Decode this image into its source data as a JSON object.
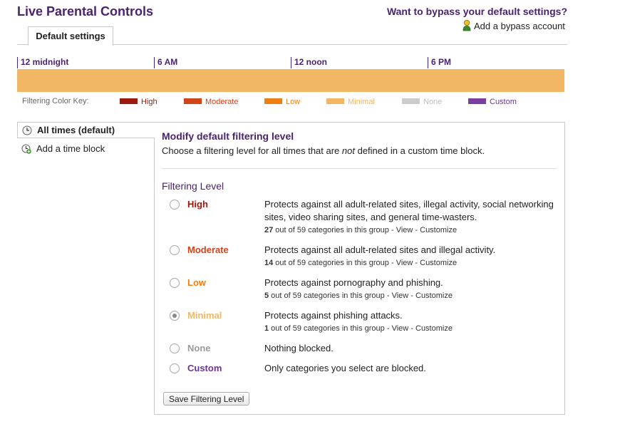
{
  "header": {
    "title": "Live Parental Controls",
    "bypass_question": "Want to bypass your default settings?",
    "bypass_link": "Add a bypass account"
  },
  "tabs": [
    {
      "label": "Default settings",
      "selected": true
    }
  ],
  "timeline": {
    "labels": [
      "12 midnight",
      "6 AM",
      "12 noon",
      "6 PM"
    ],
    "bar_color": "#f1b765"
  },
  "color_key": {
    "title": "Filtering Color Key:",
    "items": [
      {
        "label": "High",
        "color": "#9b1a0e",
        "text_color": "#9b1a0e"
      },
      {
        "label": "Moderate",
        "color": "#d2431a",
        "text_color": "#d2431a"
      },
      {
        "label": "Low",
        "color": "#f07f13",
        "text_color": "#f07f13"
      },
      {
        "label": "Minimal",
        "color": "#f1b765",
        "text_color": "#f1b765"
      },
      {
        "label": "None",
        "color": "#cccccc",
        "text_color": "#bdbdbd"
      },
      {
        "label": "Custom",
        "color": "#7b3fa2",
        "text_color": "#6b3596"
      }
    ]
  },
  "sidebar": {
    "items": [
      {
        "label": "All times (default)",
        "icon": "clock-icon",
        "selected": true
      },
      {
        "label": "Add a time block",
        "icon": "add-clock-icon",
        "selected": false
      }
    ]
  },
  "panel": {
    "title": "Modify default filtering level",
    "desc_before": "Choose a filtering level for all times that are ",
    "desc_em": "not",
    "desc_middle": " defined in a ",
    "desc_link": "custom time block",
    "desc_after": ".",
    "filtering_heading": "Filtering Level",
    "cats_of": " out of 59 categories in this group - ",
    "view_label": "View",
    "dash": " - ",
    "customize_label": "Customize",
    "levels": [
      {
        "name": "High",
        "color": "#9b1a0e",
        "desc": "Protects against all adult-related sites, illegal activity, social networking sites, video sharing sites, and general time-wasters.",
        "count": "27",
        "selected": false
      },
      {
        "name": "Moderate",
        "color": "#d2431a",
        "desc": "Protects against all adult-related sites and illegal activity.",
        "count": "14",
        "selected": false
      },
      {
        "name": "Low",
        "color": "#f07f13",
        "desc": "Protects against pornography and phishing.",
        "count": "5",
        "selected": false
      },
      {
        "name": "Minimal",
        "color": "#f1b765",
        "desc": "Protects against phishing attacks.",
        "count": "1",
        "selected": true
      },
      {
        "name": "None",
        "color": "#9a9a9a",
        "desc": "Nothing blocked.",
        "count": "",
        "selected": false
      },
      {
        "name": "Custom",
        "color": "#6b3596",
        "desc": "Only categories you select are blocked.",
        "count": "",
        "selected": false
      }
    ],
    "save_button": "Save Filtering Level"
  }
}
